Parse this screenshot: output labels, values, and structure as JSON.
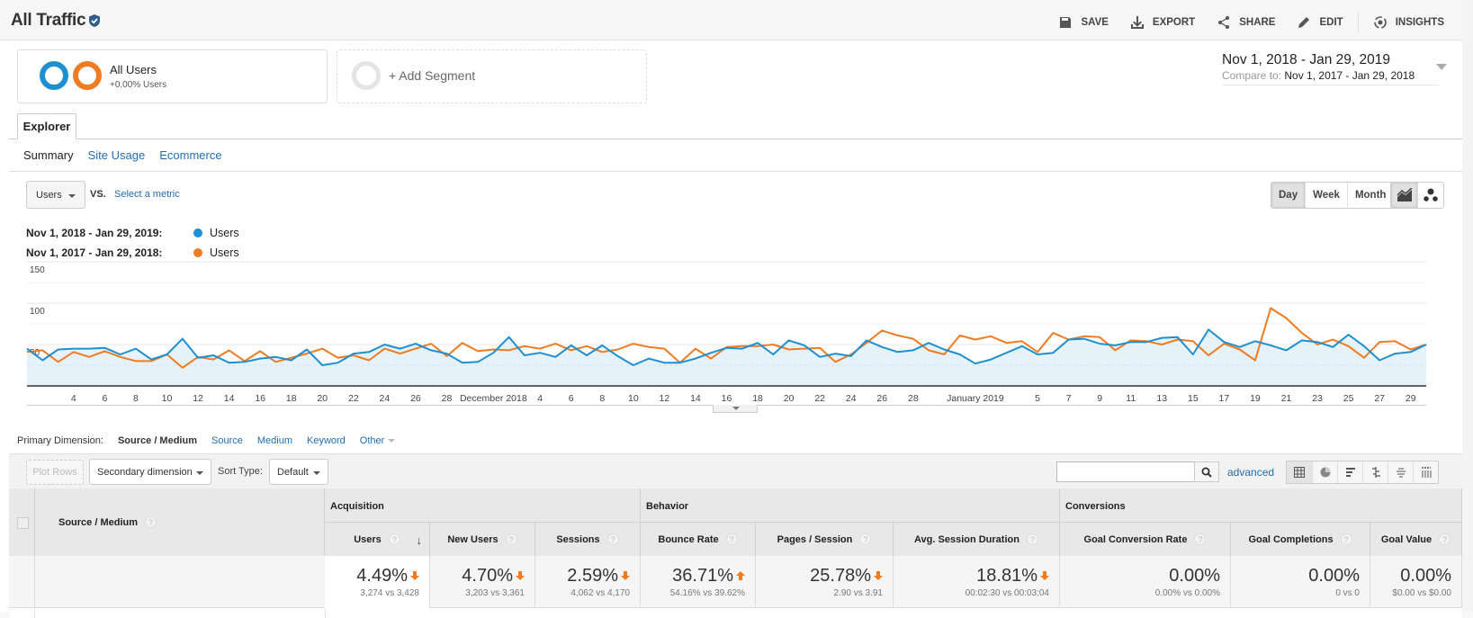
{
  "header": {
    "title": "All Traffic",
    "actions": [
      {
        "label": "SAVE",
        "icon": "save-icon"
      },
      {
        "label": "EXPORT",
        "icon": "export-icon"
      },
      {
        "label": "SHARE",
        "icon": "share-icon"
      },
      {
        "label": "EDIT",
        "icon": "edit-icon"
      },
      {
        "label": "INSIGHTS",
        "icon": "insights-icon"
      }
    ]
  },
  "segments": {
    "active": {
      "name": "All Users",
      "sub": "+0.00% Users"
    },
    "add_label": "+ Add Segment"
  },
  "date_range": {
    "main": "Nov 1, 2018 - Jan 29, 2019",
    "compare_label": "Compare to:",
    "compare": "Nov 1, 2017 - Jan 29, 2018"
  },
  "explorer": {
    "tab_label": "Explorer",
    "subtabs": [
      "Summary",
      "Site Usage",
      "Ecommerce"
    ],
    "active_subtab": "Summary",
    "metric": "Users",
    "vs_label": "VS.",
    "select_metric": "Select a metric",
    "granularity": [
      "Day",
      "Week",
      "Month"
    ],
    "active_granularity": "Day"
  },
  "legend": [
    {
      "date": "Nov 1, 2018 - Jan 29, 2019:",
      "metric": "Users",
      "color": "#1e90d0"
    },
    {
      "date": "Nov 1, 2017 - Jan 29, 2018:",
      "metric": "Users",
      "color": "#ef7b22"
    }
  ],
  "chart_data": {
    "type": "line",
    "title": "",
    "xlabel": "",
    "ylabel": "Users",
    "ylim": [
      0,
      150
    ],
    "yticks": [
      50,
      100,
      150
    ],
    "grid": true,
    "legend": "top-left",
    "x_tick_labels": [
      "4",
      "6",
      "8",
      "10",
      "12",
      "14",
      "16",
      "18",
      "20",
      "22",
      "24",
      "26",
      "28",
      "December 2018",
      "4",
      "6",
      "8",
      "10",
      "12",
      "14",
      "16",
      "18",
      "20",
      "22",
      "24",
      "26",
      "28",
      "January 2019",
      "5",
      "7",
      "9",
      "11",
      "13",
      "15",
      "17",
      "19",
      "21",
      "23",
      "25",
      "27",
      "29"
    ],
    "x_tick_days": [
      3,
      5,
      7,
      9,
      11,
      13,
      15,
      17,
      19,
      21,
      23,
      25,
      27,
      30,
      33,
      35,
      37,
      39,
      41,
      43,
      45,
      47,
      49,
      51,
      53,
      55,
      57,
      61,
      65,
      67,
      69,
      71,
      73,
      75,
      77,
      79,
      81,
      83,
      85,
      87,
      89
    ],
    "series": [
      {
        "name": "Users (Nov 1, 2018 - Jan 29, 2019)",
        "color": "#1e90d0",
        "fill": true,
        "values": [
          45,
          31,
          44,
          45,
          45,
          46,
          38,
          45,
          32,
          38,
          57,
          34,
          37,
          28,
          29,
          33,
          35,
          31,
          44,
          25,
          28,
          39,
          41,
          50,
          45,
          51,
          43,
          39,
          28,
          29,
          40,
          59,
          37,
          40,
          35,
          49,
          37,
          49,
          36,
          25,
          33,
          28,
          28,
          33,
          40,
          46,
          45,
          52,
          38,
          55,
          49,
          35,
          39,
          36,
          55,
          47,
          41,
          43,
          52,
          44,
          38,
          27,
          32,
          40,
          48,
          38,
          40,
          56,
          57,
          51,
          49,
          53,
          53,
          58,
          59,
          38,
          68,
          53,
          47,
          54,
          49,
          43,
          55,
          53,
          47,
          62,
          48,
          31,
          39,
          41,
          50
        ]
      },
      {
        "name": "Users (Nov 1, 2017 - Jan 29, 2018)",
        "color": "#ef7b22",
        "fill": false,
        "values": [
          41,
          43,
          29,
          41,
          35,
          42,
          35,
          30,
          30,
          38,
          22,
          35,
          32,
          43,
          30,
          42,
          29,
          34,
          39,
          45,
          34,
          37,
          31,
          45,
          39,
          45,
          51,
          36,
          52,
          42,
          44,
          43,
          48,
          45,
          51,
          43,
          48,
          41,
          44,
          51,
          47,
          45,
          28,
          45,
          33,
          47,
          48,
          48,
          50,
          44,
          45,
          46,
          29,
          38,
          52,
          67,
          61,
          57,
          43,
          38,
          61,
          56,
          60,
          52,
          54,
          41,
          64,
          56,
          60,
          59,
          43,
          55,
          54,
          50,
          56,
          54,
          37,
          51,
          44,
          31,
          94,
          82,
          64,
          50,
          56,
          48,
          34,
          53,
          54,
          44,
          50
        ]
      }
    ]
  },
  "primary_dimension": {
    "label": "Primary Dimension:",
    "current": "Source / Medium",
    "options": [
      "Source",
      "Medium",
      "Keyword",
      "Other"
    ]
  },
  "table_toolbar": {
    "plot_rows": "Plot Rows",
    "secondary_dimension": "Secondary dimension",
    "sort_type_label": "Sort Type:",
    "sort_type": "Default",
    "search_value": "",
    "advanced": "advanced"
  },
  "table": {
    "dimension_header": "Source / Medium",
    "groups": [
      "Acquisition",
      "Behavior",
      "Conversions"
    ],
    "columns": [
      {
        "label": "Users",
        "value": "4.49%",
        "direction": "down",
        "compare": "3,274 vs 3,428"
      },
      {
        "label": "New Users",
        "value": "4.70%",
        "direction": "down",
        "compare": "3,203 vs 3,361"
      },
      {
        "label": "Sessions",
        "value": "2.59%",
        "direction": "down",
        "compare": "4,062 vs 4,170"
      },
      {
        "label": "Bounce Rate",
        "value": "36.71%",
        "direction": "up",
        "compare": "54.16% vs 39.62%"
      },
      {
        "label": "Pages / Session",
        "value": "25.78%",
        "direction": "down",
        "compare": "2.90 vs 3.91"
      },
      {
        "label": "Avg. Session Duration",
        "value": "18.81%",
        "direction": "down",
        "compare": "00:02:30 vs 00:03:04"
      },
      {
        "label": "Goal Conversion Rate",
        "value": "0.00%",
        "direction": "",
        "compare": "0.00% vs 0.00%"
      },
      {
        "label": "Goal Completions",
        "value": "0.00%",
        "direction": "",
        "compare": "0 vs 0"
      },
      {
        "label": "Goal Value",
        "value": "0.00%",
        "direction": "",
        "compare": "$0.00 vs $0.00"
      }
    ]
  }
}
